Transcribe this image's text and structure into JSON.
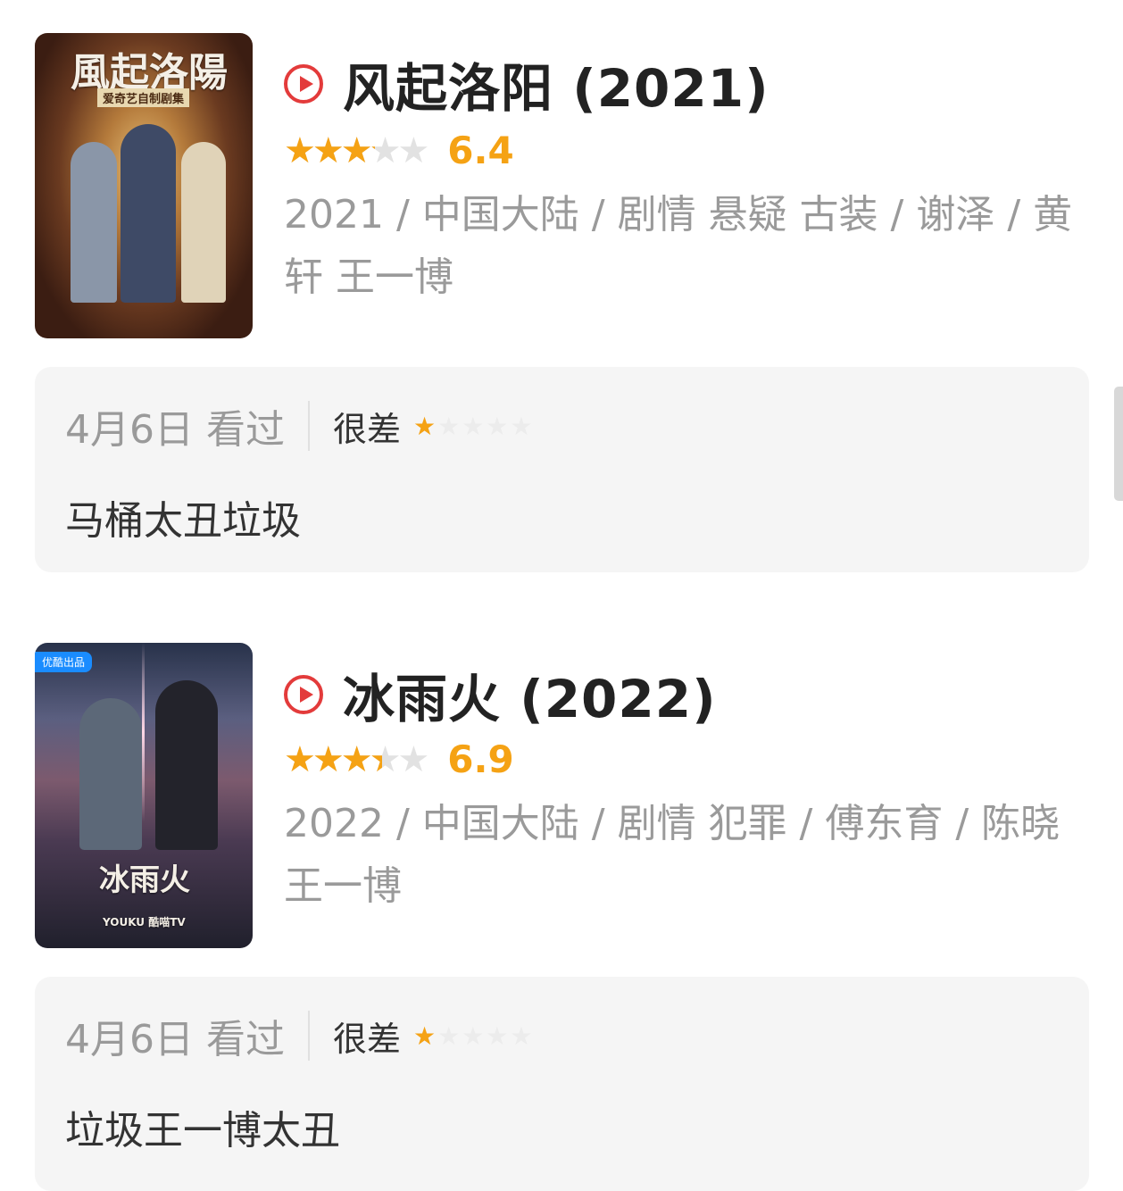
{
  "items": [
    {
      "title": "风起洛阳 (2021)",
      "rating_fraction": 0.64,
      "score": "6.4",
      "meta": "2021 / 中国大陆 / 剧情 悬疑 古装 / 谢泽 / 黄轩 王一博",
      "poster_title": "風起洛陽",
      "poster_subtitle": "爱奇艺自制剧集",
      "review": {
        "date": "4月6日 看过",
        "verdict": "很差",
        "user_rating": 1,
        "comment": "马桶太丑垃圾"
      }
    },
    {
      "title": "冰雨火 (2022)",
      "rating_fraction": 0.69,
      "score": "6.9",
      "meta": "2022 / 中国大陆 / 剧情 犯罪 / 傅东育 / 陈晓 王一博",
      "poster_badge": "优酷出品",
      "poster_title": "冰雨火",
      "poster_footer": "YOUKU  酷喵TV",
      "review": {
        "date": "4月6日 看过",
        "verdict": "很差",
        "user_rating": 1,
        "comment": "垃圾王一博太丑"
      }
    }
  ],
  "colors": {
    "accent_star": "#f5a214",
    "play_icon": "#e33b3b",
    "meta_text": "#9a9a9a",
    "review_bg": "#f5f5f5"
  },
  "icons": [
    "play-icon",
    "star-icon",
    "poster-image"
  ]
}
